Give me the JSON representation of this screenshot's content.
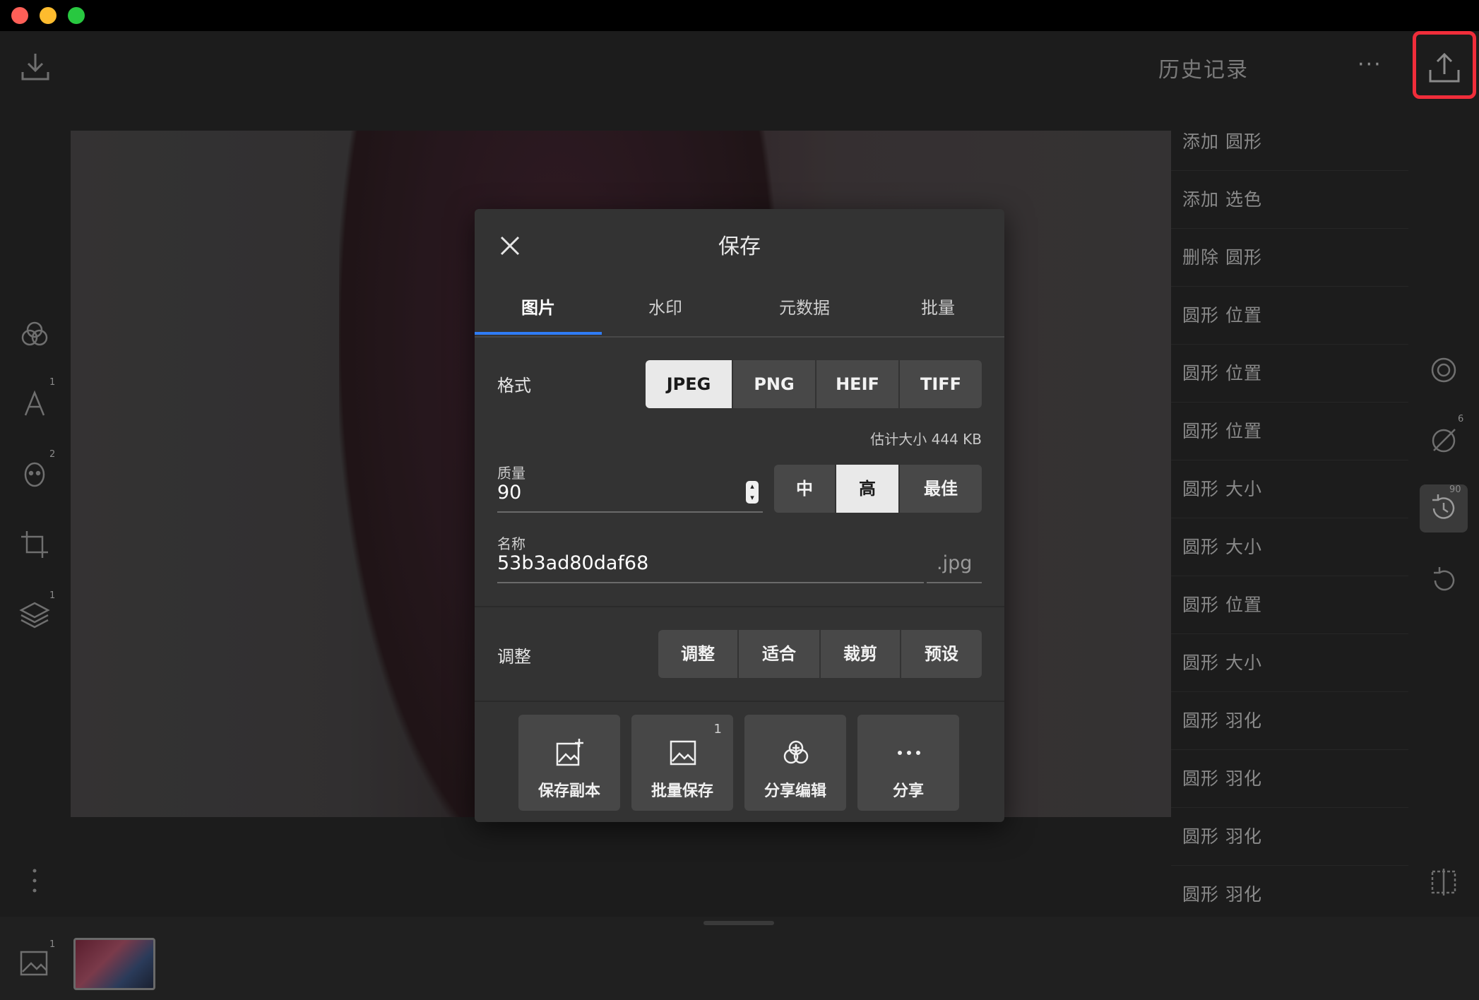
{
  "window": {
    "title": ""
  },
  "header": {
    "history_title": "历史记录",
    "more_menu": "···"
  },
  "left_toolbar": {
    "badges": {
      "text": "1",
      "retouch": "2",
      "layers": "1"
    }
  },
  "history": {
    "items": [
      "添加 圆形",
      "添加 选色",
      "删除 圆形",
      "圆形 位置",
      "圆形 位置",
      "圆形 位置",
      "圆形 大小",
      "圆形 大小",
      "圆形 位置",
      "圆形 大小",
      "圆形 羽化",
      "圆形 羽化",
      "圆形 羽化",
      "圆形 羽化"
    ]
  },
  "right_toolbar": {
    "badges": {
      "brush": "6",
      "history": "90"
    }
  },
  "bottom": {
    "image_count_badge": "1"
  },
  "dialog": {
    "title": "保存",
    "tabs": [
      "图片",
      "水印",
      "元数据",
      "批量"
    ],
    "active_tab": "图片",
    "format": {
      "label": "格式",
      "options": [
        "JPEG",
        "PNG",
        "HEIF",
        "TIFF"
      ],
      "selected": "JPEG"
    },
    "estimated_size": "估计大小 444 KB",
    "quality": {
      "label": "质量",
      "value": "90",
      "presets": [
        "中",
        "高",
        "最佳"
      ],
      "selected": "高"
    },
    "name": {
      "label": "名称",
      "value": "53b3ad80daf68",
      "extension": ".jpg"
    },
    "resize": {
      "label": "调整",
      "options": [
        "调整",
        "适合",
        "裁剪",
        "预设"
      ]
    },
    "actions": [
      {
        "label": "保存副本",
        "icon": "image-plus-icon"
      },
      {
        "label": "批量保存",
        "icon": "image-icon",
        "badge": "1"
      },
      {
        "label": "分享编辑",
        "icon": "share-edits-icon"
      },
      {
        "label": "分享",
        "icon": "ellipsis-icon"
      }
    ]
  }
}
